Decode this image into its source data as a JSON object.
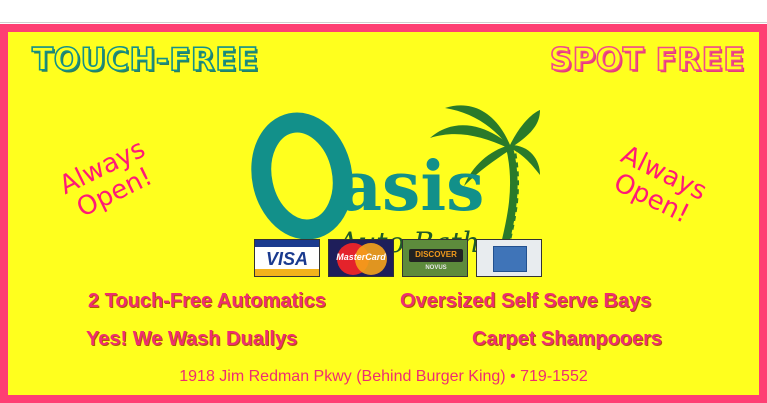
{
  "ad": {
    "headline_left": "TOUCH-FREE",
    "headline_right": "SPOT FREE",
    "always_left_line1": "Always",
    "always_left_line2": "Open!",
    "always_right_line1": "Always",
    "always_right_line2": "Open!",
    "logo_word": "asis",
    "logo_subtitle": "Auto Bath",
    "cards": {
      "visa": "VISA",
      "mastercard": "MasterCard",
      "discover": "DISCOVER",
      "discover_sub": "NOVUS"
    },
    "features": [
      "2 Touch-Free Automatics",
      "Oversized Self Serve Bays",
      "Yes!  We Wash Duallys",
      "Carpet Shampooers"
    ],
    "address": "1918 Jim Redman Pkwy (Behind Burger King) • 719-1552",
    "colors": {
      "border_pink": "#fe3f73",
      "background_yellow": "#ffff1e",
      "logo_teal": "#12908a",
      "palm_green": "#2a7a2a",
      "text_pink": "#ee2e71"
    },
    "icons": [
      "palm-tree-icon",
      "visa-card-icon",
      "mastercard-icon",
      "discover-card-icon",
      "amex-card-icon"
    ]
  }
}
